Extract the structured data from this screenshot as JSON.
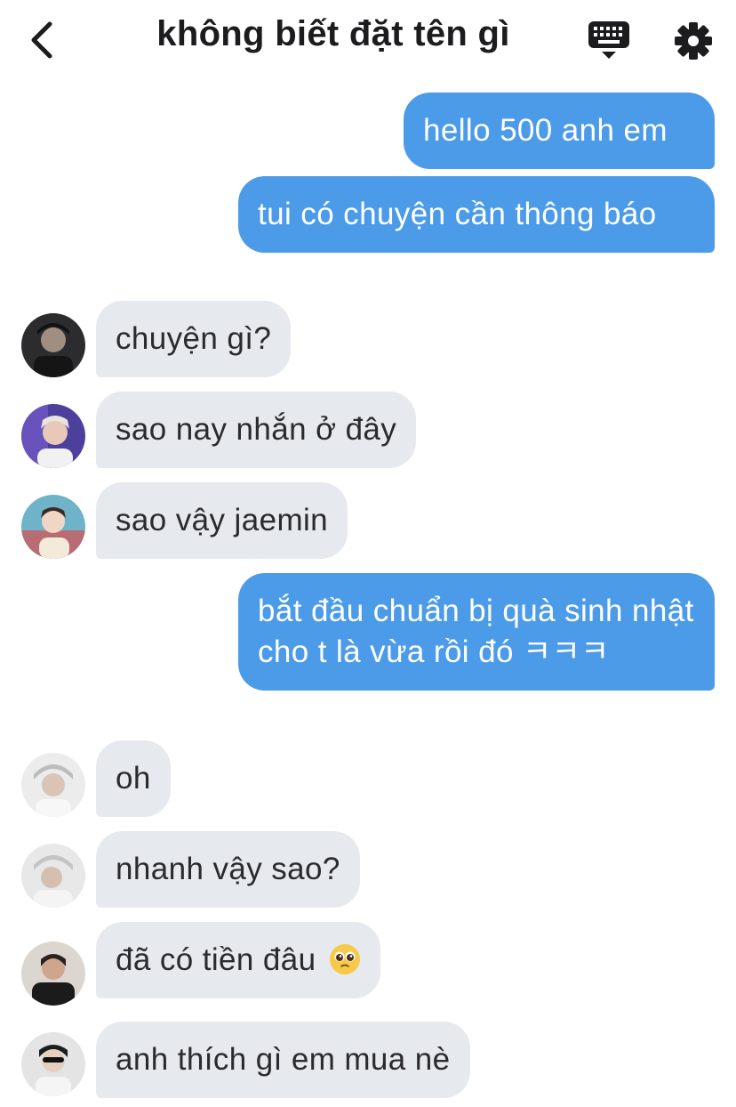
{
  "header": {
    "title": "không biết đặt tên gì",
    "back_icon": "chevron-left-icon",
    "keyboard_icon": "keyboard-icon",
    "settings_icon": "gear-icon"
  },
  "colors": {
    "outgoing_bubble": "#4b9be8",
    "incoming_bubble": "#e6e9ed"
  },
  "messages": [
    {
      "side": "out",
      "text": "hello 500 anh em"
    },
    {
      "side": "out",
      "text": "tui có chuyện cần thông báo"
    },
    {
      "side": "in",
      "text": "chuyện gì?"
    },
    {
      "side": "in",
      "text": "sao nay nhắn ở đây"
    },
    {
      "side": "in",
      "text": "sao vậy jaemin"
    },
    {
      "side": "out",
      "text": "bắt đầu chuẩn bị quà sinh nhật cho t là vừa rồi đó ㅋㅋㅋ"
    },
    {
      "side": "in",
      "text": "oh"
    },
    {
      "side": "in",
      "text": "nhanh vậy sao?"
    },
    {
      "side": "in",
      "text": "đã có tiền đâu",
      "emoji": "pleading-face-emoji"
    },
    {
      "side": "in",
      "text": "anh thích gì em mua nè"
    }
  ]
}
